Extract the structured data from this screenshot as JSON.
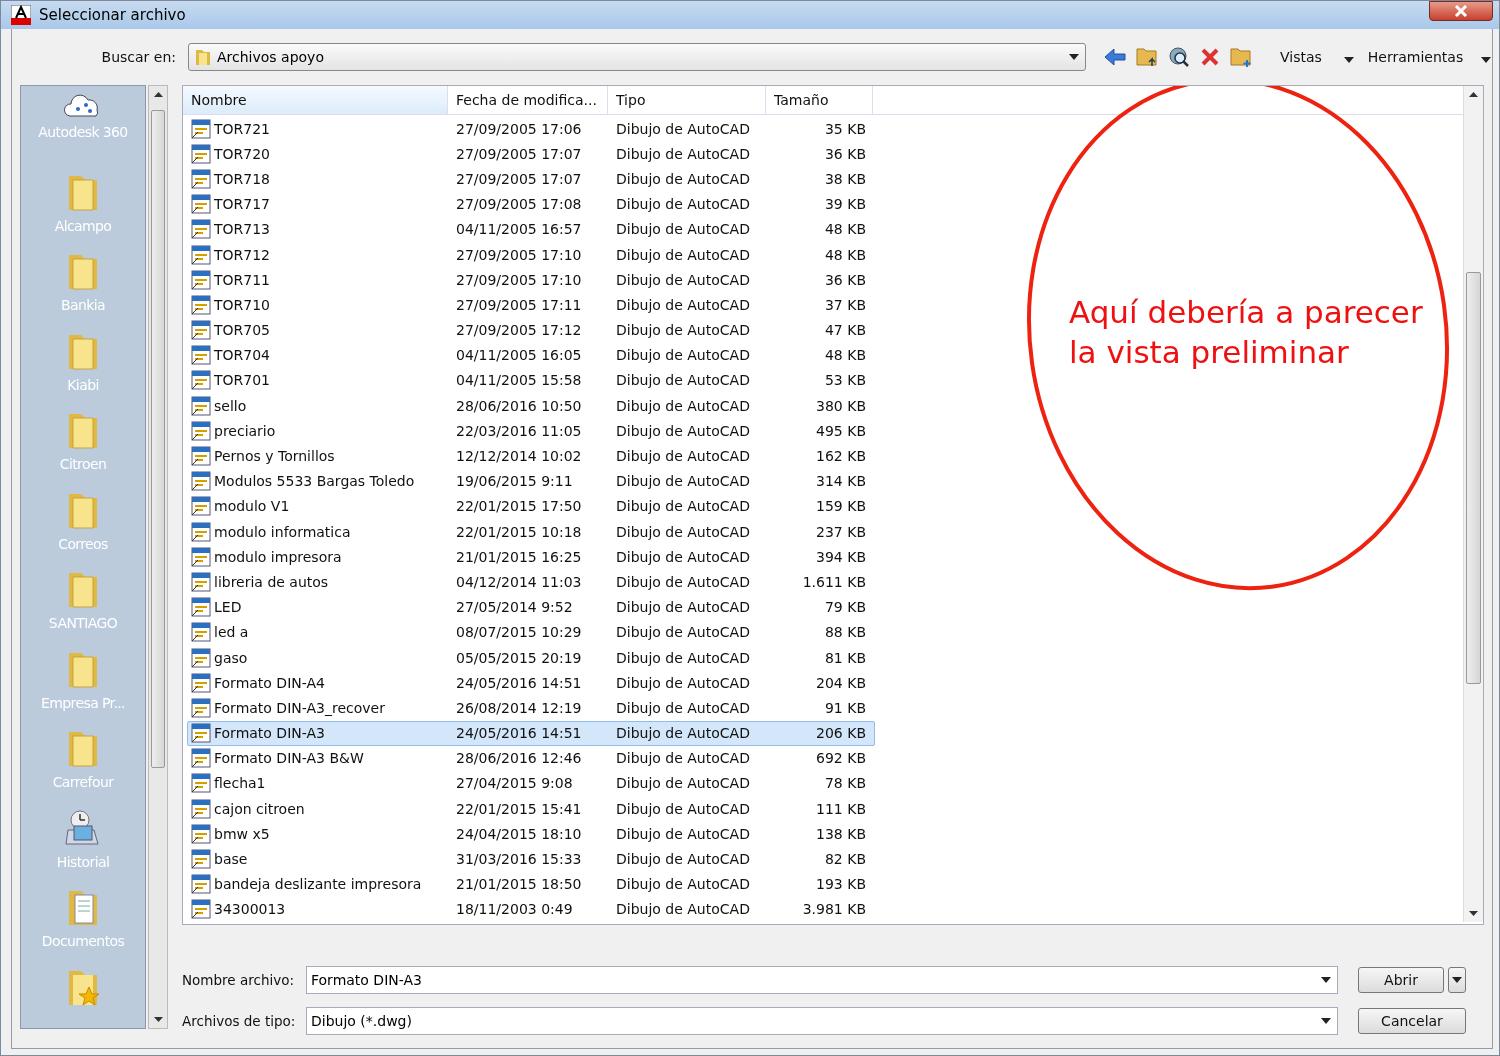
{
  "window": {
    "title": "Seleccionar archivo"
  },
  "look_in": {
    "label": "Buscar en:",
    "value": "Archivos apoyo"
  },
  "toolbar": {
    "views": "Vistas",
    "tools": "Herramientas"
  },
  "sidebar": {
    "items": [
      {
        "kind": "cloud",
        "label": "Autodesk 360"
      },
      {
        "kind": "folder",
        "label": "Alcampo"
      },
      {
        "kind": "folder",
        "label": "Bankia"
      },
      {
        "kind": "folder",
        "label": "Kiabi"
      },
      {
        "kind": "folder",
        "label": "Citroen"
      },
      {
        "kind": "folder",
        "label": "Correos"
      },
      {
        "kind": "folder",
        "label": "SANTIAGO"
      },
      {
        "kind": "folder",
        "label": "Empresa Pr..."
      },
      {
        "kind": "folder",
        "label": "Carrefour"
      },
      {
        "kind": "history",
        "label": "Historial"
      },
      {
        "kind": "documents",
        "label": "Documentos"
      },
      {
        "kind": "favorites"
      }
    ]
  },
  "table": {
    "columns": [
      "Nombre",
      "Fecha de modifica...",
      "Tipo",
      "Tamaño"
    ],
    "rows": [
      {
        "name": "TOR721",
        "date": "27/09/2005 17:06",
        "type": "Dibujo de AutoCAD",
        "size": "35 KB",
        "selected": false
      },
      {
        "name": "TOR720",
        "date": "27/09/2005 17:07",
        "type": "Dibujo de AutoCAD",
        "size": "36 KB",
        "selected": false
      },
      {
        "name": "TOR718",
        "date": "27/09/2005 17:07",
        "type": "Dibujo de AutoCAD",
        "size": "38 KB",
        "selected": false
      },
      {
        "name": "TOR717",
        "date": "27/09/2005 17:08",
        "type": "Dibujo de AutoCAD",
        "size": "39 KB",
        "selected": false
      },
      {
        "name": "TOR713",
        "date": "04/11/2005 16:57",
        "type": "Dibujo de AutoCAD",
        "size": "48 KB",
        "selected": false
      },
      {
        "name": "TOR712",
        "date": "27/09/2005 17:10",
        "type": "Dibujo de AutoCAD",
        "size": "48 KB",
        "selected": false
      },
      {
        "name": "TOR711",
        "date": "27/09/2005 17:10",
        "type": "Dibujo de AutoCAD",
        "size": "36 KB",
        "selected": false
      },
      {
        "name": "TOR710",
        "date": "27/09/2005 17:11",
        "type": "Dibujo de AutoCAD",
        "size": "37 KB",
        "selected": false
      },
      {
        "name": "TOR705",
        "date": "27/09/2005 17:12",
        "type": "Dibujo de AutoCAD",
        "size": "47 KB",
        "selected": false
      },
      {
        "name": "TOR704",
        "date": "04/11/2005 16:05",
        "type": "Dibujo de AutoCAD",
        "size": "48 KB",
        "selected": false
      },
      {
        "name": "TOR701",
        "date": "04/11/2005 15:58",
        "type": "Dibujo de AutoCAD",
        "size": "53 KB",
        "selected": false
      },
      {
        "name": "sello",
        "date": "28/06/2016 10:50",
        "type": "Dibujo de AutoCAD",
        "size": "380 KB",
        "selected": false
      },
      {
        "name": "preciario",
        "date": "22/03/2016 11:05",
        "type": "Dibujo de AutoCAD",
        "size": "495 KB",
        "selected": false
      },
      {
        "name": "Pernos y Tornillos",
        "date": "12/12/2014 10:02",
        "type": "Dibujo de AutoCAD",
        "size": "162 KB",
        "selected": false
      },
      {
        "name": "Modulos 5533 Bargas Toledo",
        "date": "19/06/2015 9:11",
        "type": "Dibujo de AutoCAD",
        "size": "314 KB",
        "selected": false
      },
      {
        "name": "modulo V1",
        "date": "22/01/2015 17:50",
        "type": "Dibujo de AutoCAD",
        "size": "159 KB",
        "selected": false
      },
      {
        "name": "modulo informatica",
        "date": "22/01/2015 10:18",
        "type": "Dibujo de AutoCAD",
        "size": "237 KB",
        "selected": false
      },
      {
        "name": "modulo impresora",
        "date": "21/01/2015 16:25",
        "type": "Dibujo de AutoCAD",
        "size": "394 KB",
        "selected": false
      },
      {
        "name": "libreria de autos",
        "date": "04/12/2014 11:03",
        "type": "Dibujo de AutoCAD",
        "size": "1.611 KB",
        "selected": false
      },
      {
        "name": "LED",
        "date": "27/05/2014 9:52",
        "type": "Dibujo de AutoCAD",
        "size": "79 KB",
        "selected": false
      },
      {
        "name": "led a",
        "date": "08/07/2015 10:29",
        "type": "Dibujo de AutoCAD",
        "size": "88 KB",
        "selected": false
      },
      {
        "name": "gaso",
        "date": "05/05/2015 20:19",
        "type": "Dibujo de AutoCAD",
        "size": "81 KB",
        "selected": false
      },
      {
        "name": "Formato DIN-A4",
        "date": "24/05/2016 14:51",
        "type": "Dibujo de AutoCAD",
        "size": "204 KB",
        "selected": false
      },
      {
        "name": "Formato DIN-A3_recover",
        "date": "26/08/2014 12:19",
        "type": "Dibujo de AutoCAD",
        "size": "91 KB",
        "selected": false
      },
      {
        "name": "Formato DIN-A3",
        "date": "24/05/2016 14:51",
        "type": "Dibujo de AutoCAD",
        "size": "206 KB",
        "selected": true
      },
      {
        "name": "Formato DIN-A3 B&W",
        "date": "28/06/2016 12:46",
        "type": "Dibujo de AutoCAD",
        "size": "692 KB",
        "selected": false
      },
      {
        "name": "flecha1",
        "date": "27/04/2015 9:08",
        "type": "Dibujo de AutoCAD",
        "size": "78 KB",
        "selected": false
      },
      {
        "name": "cajon citroen",
        "date": "22/01/2015 15:41",
        "type": "Dibujo de AutoCAD",
        "size": "111 KB",
        "selected": false
      },
      {
        "name": "bmw x5",
        "date": "24/04/2015 18:10",
        "type": "Dibujo de AutoCAD",
        "size": "138 KB",
        "selected": false
      },
      {
        "name": "base",
        "date": "31/03/2016 15:33",
        "type": "Dibujo de AutoCAD",
        "size": "82 KB",
        "selected": false
      },
      {
        "name": "bandeja deslizante impresora",
        "date": "21/01/2015 18:50",
        "type": "Dibujo de AutoCAD",
        "size": "193 KB",
        "selected": false
      },
      {
        "name": "34300013",
        "date": "18/11/2003 0:49",
        "type": "Dibujo de AutoCAD",
        "size": "3.981 KB",
        "selected": false
      }
    ]
  },
  "annotation": {
    "text": "Aquí debería a parecer la vista preliminar"
  },
  "file_name": {
    "label": "Nombre archivo:",
    "value": "Formato DIN-A3"
  },
  "file_type": {
    "label": "Archivos de tipo:",
    "value": "Dibujo (*.dwg)"
  },
  "buttons": {
    "open": "Abrir",
    "cancel": "Cancelar"
  }
}
